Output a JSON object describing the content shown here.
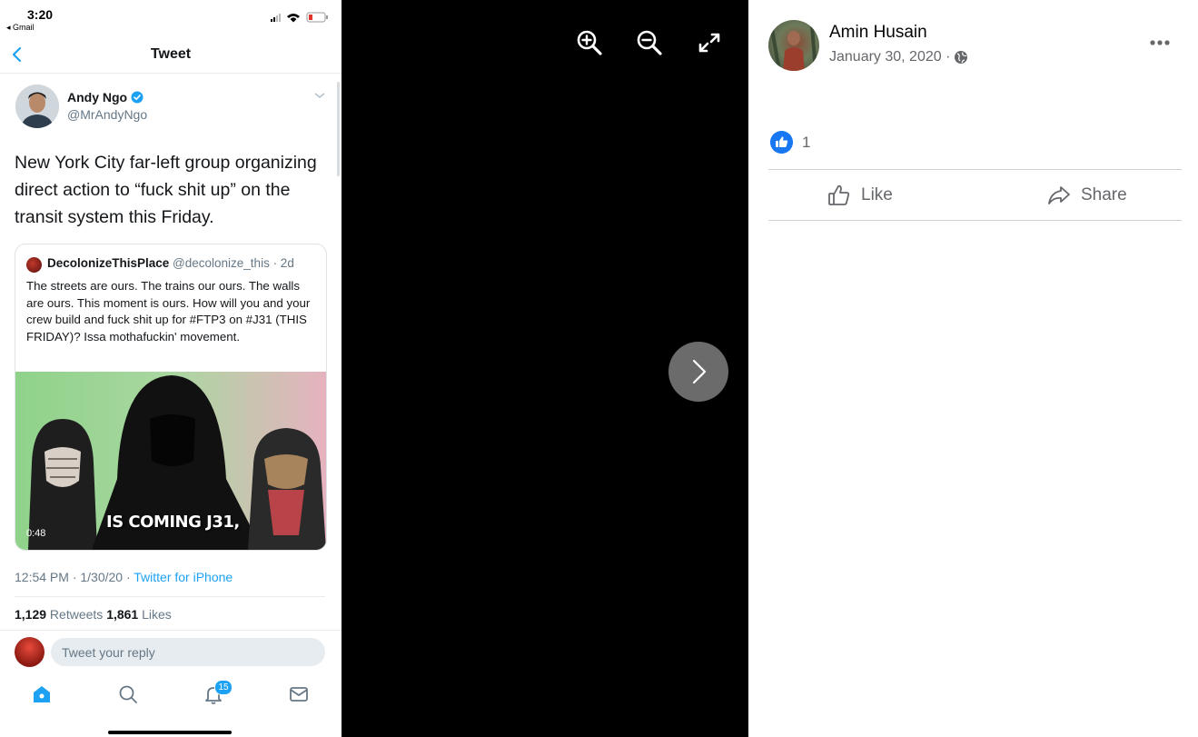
{
  "phone": {
    "status": {
      "time": "3:20",
      "back_app": "◂ Gmail"
    },
    "nav": {
      "title": "Tweet"
    },
    "tweet": {
      "author_name": "Andy Ngo",
      "author_handle": "@MrAndyNgo",
      "text": "New York City far-left group organizing direct action to “fuck shit up” on the transit system this Friday.",
      "timestamp": "12:54 PM · 1/30/20 · ",
      "source": "Twitter for iPhone",
      "retweets_count": "1,129",
      "retweets_label": " Retweets ",
      "likes_count": "1,861",
      "likes_label": " Likes"
    },
    "quote": {
      "name": "DecolonizeThisPlace",
      "handle_time": " @decolonize_this · 2d",
      "text": "The streets are ours. The trains our ours. The walls are ours. This moment is ours. How will you and your crew build and fuck shit up for #FTP3 on #J31 (THIS FRIDAY)? Issa mothafuckin' movement.",
      "video_caption": "IS COMING J31,",
      "video_duration": "0:48"
    },
    "reply": {
      "placeholder": "Tweet your reply"
    },
    "tabbar": {
      "notifications_badge": "15"
    },
    "colors": {
      "accent": "#1da1f2"
    }
  },
  "facebook": {
    "author": "Amin Husain",
    "date": "January 30, 2020 · ",
    "like_count": "1",
    "like_label": "Like",
    "share_label": "Share",
    "colors": {
      "brand": "#1877f2"
    }
  },
  "viewer": {
    "icons": [
      "zoom-in-icon",
      "zoom-out-icon",
      "fullscreen-icon",
      "chevron-right-icon"
    ]
  }
}
